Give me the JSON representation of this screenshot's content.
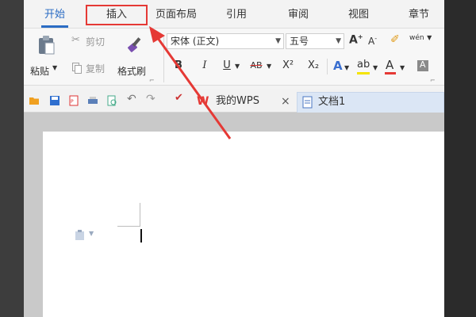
{
  "menu": {
    "tabs": [
      "开始",
      "插入",
      "页面布局",
      "引用",
      "审阅",
      "视图",
      "章节"
    ]
  },
  "ribbon": {
    "paste_label": "粘贴",
    "cut_label": "剪切",
    "copy_label": "复制",
    "format_painter_label": "格式刷",
    "font_name": "宋体 (正文)",
    "font_size": "五号",
    "bold": "B",
    "italic": "I",
    "underline": "U",
    "strikethrough": "AB",
    "superscript": "X²",
    "subscript": "X₂",
    "pinyin_glyph": "wén"
  },
  "quickbar": {
    "wps_tab_label": "我的WPS",
    "close_glyph": "×",
    "doc_tab_label": "文档1"
  },
  "colors": {
    "accent": "#2b6cc4",
    "annotation": "#e53935",
    "highlight_yellow": "#f5e400",
    "font_color_bar": "#e53935"
  }
}
